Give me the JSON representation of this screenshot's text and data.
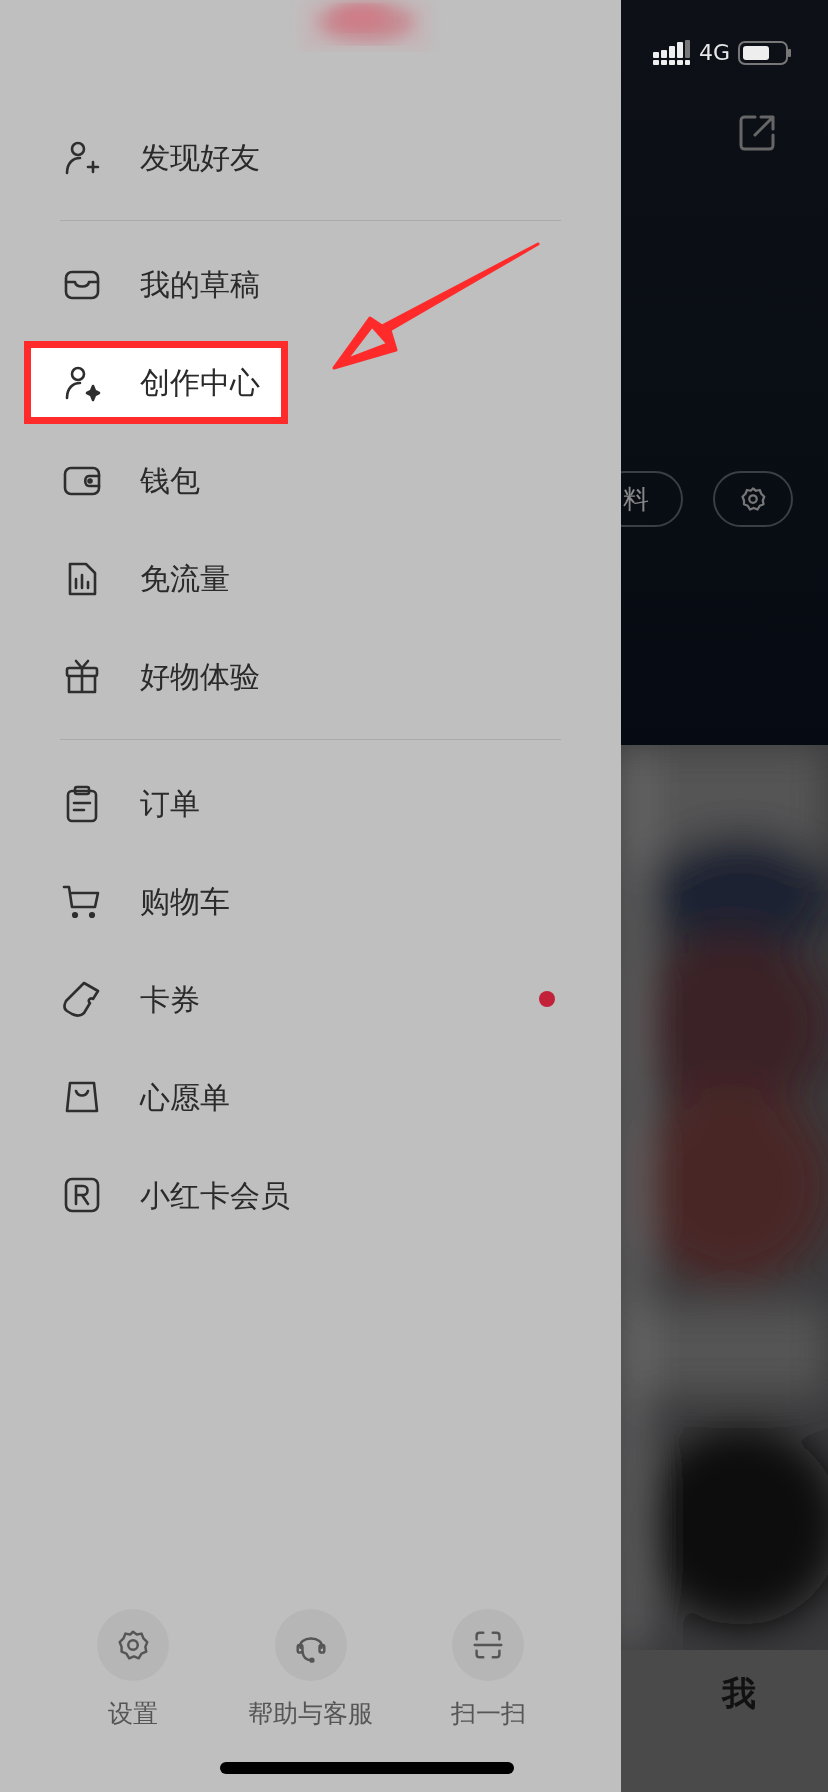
{
  "drawer": {
    "groups": [
      {
        "items": [
          {
            "label": "发现好友",
            "highlighted": false,
            "dot": false
          }
        ]
      },
      {
        "items": [
          {
            "label": "我的草稿",
            "highlighted": false,
            "dot": false
          },
          {
            "label": "创作中心",
            "highlighted": true,
            "dot": false
          },
          {
            "label": "钱包",
            "highlighted": false,
            "dot": false
          },
          {
            "label": "免流量",
            "highlighted": false,
            "dot": false
          },
          {
            "label": "好物体验",
            "highlighted": false,
            "dot": false
          }
        ]
      },
      {
        "items": [
          {
            "label": "订单",
            "highlighted": false,
            "dot": false
          },
          {
            "label": "购物车",
            "highlighted": false,
            "dot": false
          },
          {
            "label": "卡券",
            "highlighted": false,
            "dot": true
          },
          {
            "label": "心愿单",
            "highlighted": false,
            "dot": false
          },
          {
            "label": "小红卡会员",
            "highlighted": false,
            "dot": false
          }
        ]
      }
    ],
    "footer": [
      {
        "label": "设置"
      },
      {
        "label": "帮助与客服"
      },
      {
        "label": "扫一扫"
      }
    ]
  },
  "status_bar": {
    "network": "4G"
  },
  "profile": {
    "edit_button": "料"
  },
  "tab_bar": {
    "tab": "我"
  }
}
